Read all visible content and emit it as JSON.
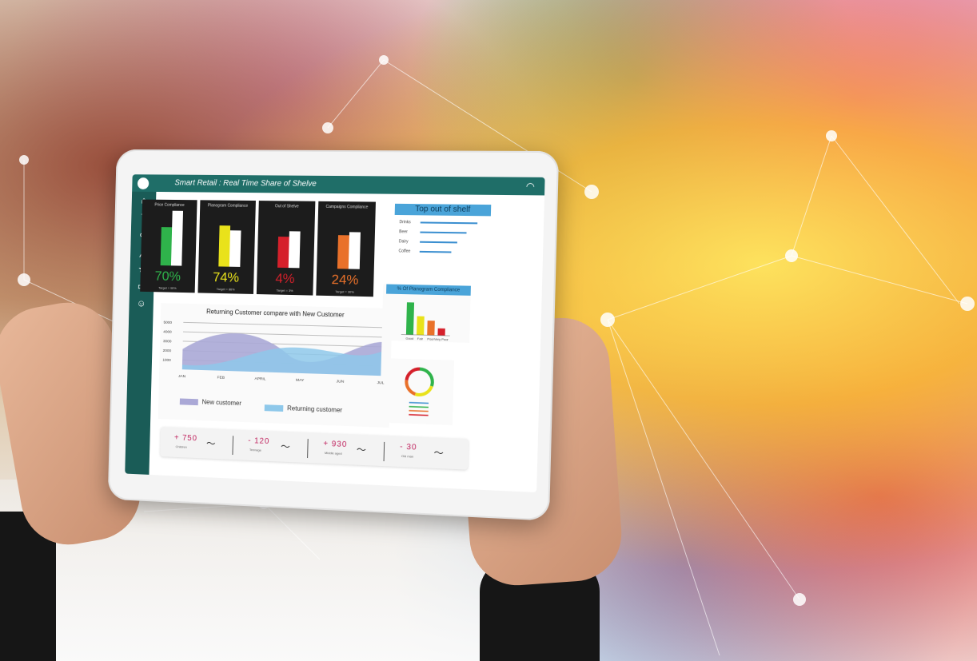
{
  "dashboard": {
    "title": "Smart Retail : Real Time Share of Shelve",
    "kpis": [
      {
        "label": "Price Compliance",
        "value": "70%",
        "target": "Target = 90%",
        "color": "#2fb34b",
        "fill": 0.7
      },
      {
        "label": "Planogram Compliance",
        "value": "74%",
        "target": "Target = 86%",
        "color": "#e9e21b",
        "fill": 0.74
      },
      {
        "label": "Out of Shelve",
        "value": "4%",
        "target": "Target = 3%",
        "color": "#d5202b",
        "fill": 0.55
      },
      {
        "label": "Campaigns Compliance",
        "value": "24%",
        "target": "Target = 30%",
        "color": "#e9712a",
        "fill": 0.6
      }
    ],
    "top_out_of_shelf": {
      "title": "Top out of shelf",
      "rows": [
        {
          "label": "Drinks",
          "value": 1.0
        },
        {
          "label": "Beer",
          "value": 0.82
        },
        {
          "label": "Dairy",
          "value": 0.66
        },
        {
          "label": "Coffee",
          "value": 0.55
        }
      ]
    },
    "planogram_panel": {
      "title": "% Of Planogram Compliance",
      "categories": [
        "Good",
        "Fair",
        "Poor",
        "Very Poor"
      ],
      "values": [
        1.0,
        0.58,
        0.45,
        0.22
      ],
      "colors": [
        "#2fb34b",
        "#e9e21b",
        "#e9712a",
        "#d5202b"
      ]
    },
    "area_chart": {
      "title": "Returning Customer compare with New Customer",
      "y_ticks": [
        "5000",
        "4000",
        "3000",
        "2000",
        "1000"
      ],
      "x_ticks": [
        "JAN",
        "FEB",
        "APRIL",
        "MAY",
        "JUN",
        "JUL"
      ],
      "legend_new": "New customer",
      "legend_returning": "Returning customer",
      "color_new": "#aaa8d6",
      "color_returning": "#8ec8ea"
    },
    "stats": [
      {
        "value": "+ 750",
        "label": "Children"
      },
      {
        "value": "- 120",
        "label": "Teenage"
      },
      {
        "value": "+ 930",
        "label": "Middle aged"
      },
      {
        "value": "- 30",
        "label": "Old man"
      }
    ],
    "sidebar_icons": [
      "home-icon",
      "seven-icon",
      "link-icon",
      "graph-icon",
      "star-icon",
      "folder-icon",
      "user-icon"
    ]
  }
}
